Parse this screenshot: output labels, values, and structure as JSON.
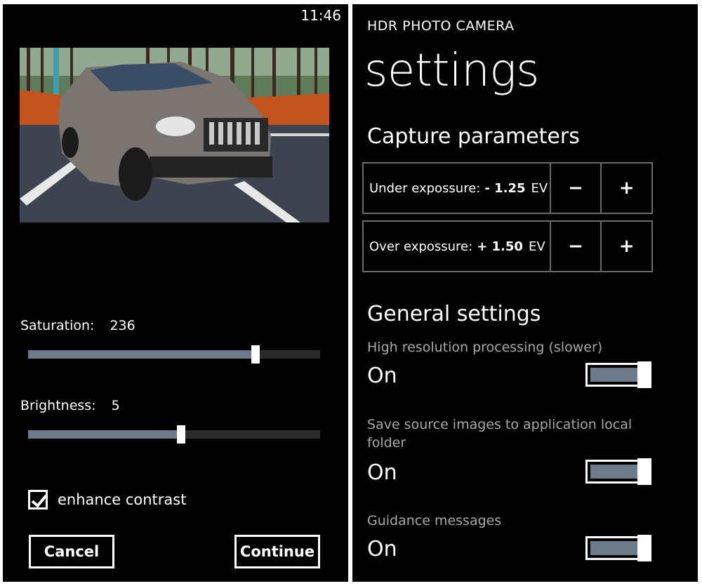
{
  "status_bar": {
    "time": "11:46"
  },
  "editor": {
    "saturation": {
      "label": "Saturation:",
      "value": "236",
      "level": 0.78
    },
    "brightness": {
      "label": "Brightness:",
      "value": "5",
      "level": 0.525
    },
    "enhance_contrast": {
      "label": "enhance contrast",
      "checked": true
    },
    "cancel_label": "Cancel",
    "continue_label": "Continue"
  },
  "settings": {
    "app_title": "HDR PHOTO CAMERA",
    "page_title": "settings",
    "capture_section": "Capture parameters",
    "under_exposure": {
      "label": "Under expossure:",
      "value": "- 1.25",
      "unit": "EV"
    },
    "over_exposure": {
      "label": "Over expossure:",
      "value": "+ 1.50",
      "unit": "EV"
    },
    "minus_symbol": "−",
    "plus_symbol": "+",
    "general_section": "General settings",
    "high_res": {
      "label": "High resolution processing (slower)",
      "value": "On"
    },
    "save_source": {
      "label": "Save source images to application local folder",
      "value": "On"
    },
    "guidance": {
      "label": "Guidance messages",
      "value": "On"
    }
  },
  "colors": {
    "slider_fill": "#6d7a89",
    "slider_track": "#2b2b2b",
    "accent_border": "#6b6b6b"
  }
}
